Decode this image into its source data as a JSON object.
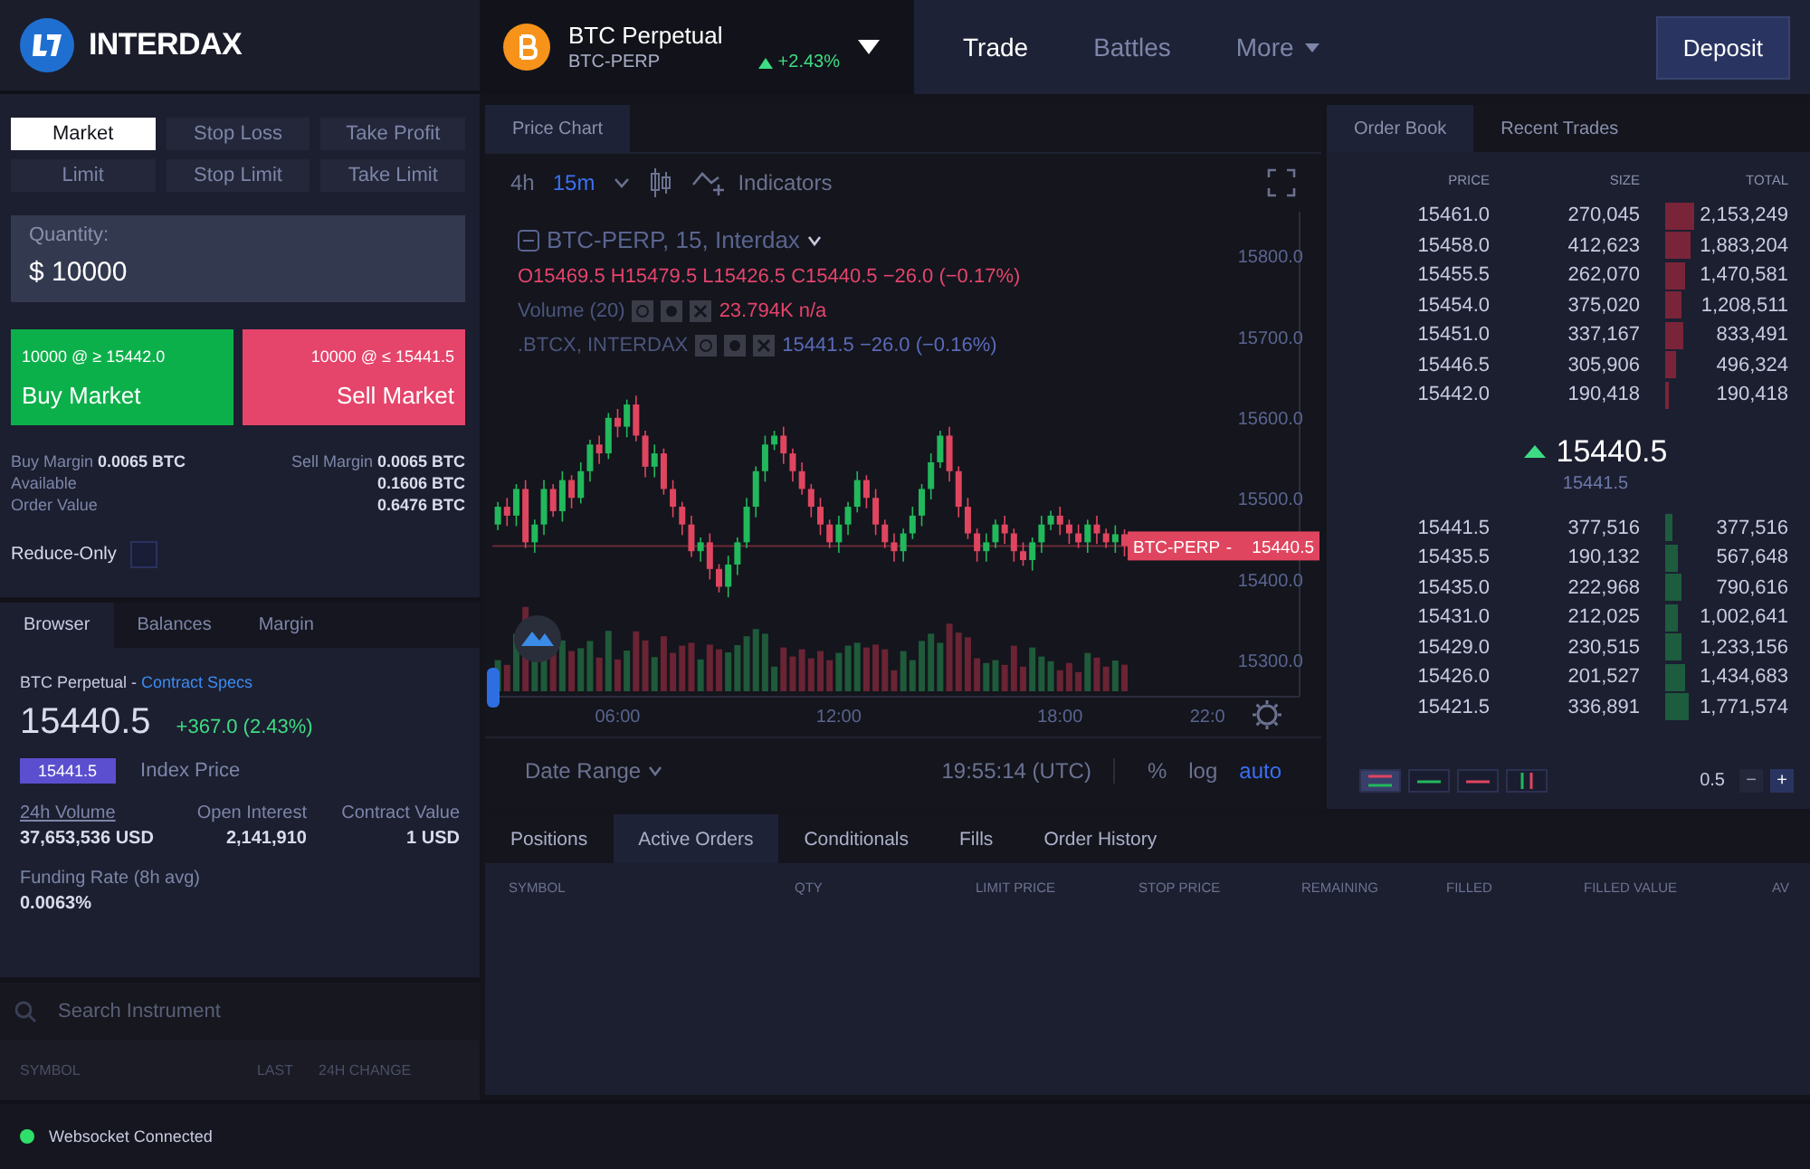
{
  "brand": {
    "name": "INTERDAX"
  },
  "instrument": {
    "name": "BTC Perpetual",
    "symbol": "BTC-PERP",
    "change": "+2.43%"
  },
  "nav": [
    {
      "label": "Trade",
      "selected": true,
      "dropdown": false
    },
    {
      "label": "Battles",
      "selected": false,
      "dropdown": false
    },
    {
      "label": "More",
      "selected": false,
      "dropdown": true
    }
  ],
  "deposit_button": "Deposit",
  "order_types": [
    {
      "label": "Market",
      "selected": true
    },
    {
      "label": "Stop Loss",
      "selected": false
    },
    {
      "label": "Take Profit",
      "selected": false
    },
    {
      "label": "Limit",
      "selected": false
    },
    {
      "label": "Stop Limit",
      "selected": false
    },
    {
      "label": "Take Limit",
      "selected": false
    }
  ],
  "quantity": {
    "label": "Quantity:",
    "value": "$ 10000"
  },
  "buy": {
    "detail": "10000 @ ≥ 15442.0",
    "label": "Buy Market"
  },
  "sell": {
    "detail": "10000 @ ≤ 15441.5",
    "label": "Sell Market"
  },
  "margins": {
    "buy_label": "Buy Margin",
    "buy_value": "0.0065 BTC",
    "sell_label": "Sell Margin",
    "sell_value": "0.0065 BTC"
  },
  "balances": [
    {
      "label": "Available",
      "value": "0.1606 BTC"
    },
    {
      "label": "Order Value",
      "value": "0.6476 BTC"
    }
  ],
  "reduce_only": {
    "label": "Reduce-Only",
    "checked": false
  },
  "info_tabs": [
    {
      "label": "Browser",
      "selected": true
    },
    {
      "label": "Balances",
      "selected": false
    },
    {
      "label": "Margin",
      "selected": false
    }
  ],
  "contract": {
    "title": "BTC Perpetual -",
    "link": "Contract Specs",
    "last": "15440.5",
    "change": "+367.0 (2.43%)",
    "index_value": "15441.5",
    "index_label": "Index Price",
    "stats": [
      {
        "label": "24h Volume",
        "value": "37,653,536 USD",
        "underlined": true
      },
      {
        "label": "Open Interest",
        "value": "2,141,910",
        "underlined": false
      },
      {
        "label": "Contract Value",
        "value": "1 USD",
        "underlined": false
      }
    ],
    "funding": {
      "label": "Funding Rate (8h avg)",
      "value": "0.0063%"
    }
  },
  "search": {
    "placeholder": "Search Instrument"
  },
  "instrument_columns": [
    "SYMBOL",
    "LAST",
    "24H CHANGE"
  ],
  "chart_panel": {
    "tab": "Price Chart",
    "intervals": [
      {
        "label": "4h",
        "selected": false
      },
      {
        "label": "15m",
        "selected": true
      }
    ],
    "indicators": "Indicators",
    "legend": {
      "title": "BTC-PERP, 15, Interdax",
      "ohlc": "O15469.5 H15479.5 L15426.5 C15440.5 −26.0 (−0.17%)",
      "volume_label": "Volume (20)",
      "volume_value": "23.794K n/a",
      "index_label": ".BTCX, INTERDAX",
      "index_value": "15441.5 −26.0 (−0.16%)"
    },
    "chart_data": {
      "type": "candlestick",
      "x": [
        2.75,
        3,
        3.25,
        3.5,
        3.75,
        4,
        4.25,
        4.5,
        4.75,
        5,
        5.25,
        5.5,
        5.75,
        6,
        6.25,
        6.5,
        6.75,
        7,
        7.25,
        7.5,
        7.75,
        8,
        8.25,
        8.5,
        8.75,
        9,
        9.25,
        9.5,
        9.75,
        10,
        10.25,
        10.5,
        10.75,
        11,
        11.25,
        11.5,
        11.75,
        12,
        12.25,
        12.5,
        12.75,
        13,
        13.25,
        13.5,
        13.75,
        14,
        14.25,
        14.5,
        14.75,
        15,
        15.25,
        15.5,
        15.75,
        16,
        16.25,
        16.5,
        16.75,
        17,
        17.25,
        17.5,
        17.75,
        18,
        18.25,
        18.5,
        18.75,
        19,
        19.25,
        19.5,
        19.75
      ],
      "ohlc": [
        [
          15467,
          15495,
          15460,
          15489
        ],
        [
          15489,
          15500,
          15465,
          15478
        ],
        [
          15478,
          15517,
          15465,
          15511
        ],
        [
          15511,
          15522,
          15438,
          15445
        ],
        [
          15445,
          15473,
          15432,
          15467
        ],
        [
          15467,
          15522,
          15454,
          15511
        ],
        [
          15511,
          15517,
          15476.5,
          15483.5
        ],
        [
          15483.5,
          15533,
          15470.5,
          15522
        ],
        [
          15522,
          15528,
          15487,
          15500
        ],
        [
          15500,
          15544,
          15493,
          15533
        ],
        [
          15533,
          15572,
          15520,
          15566
        ],
        [
          15566,
          15577,
          15542,
          15555
        ],
        [
          15555,
          15605,
          15548,
          15599
        ],
        [
          15599,
          15610,
          15575,
          15588
        ],
        [
          15588,
          15621.5,
          15575,
          15615.5
        ],
        [
          15615.5,
          15626.5,
          15570,
          15577
        ],
        [
          15577,
          15583,
          15525.5,
          15538.5
        ],
        [
          15538.5,
          15566,
          15525.5,
          15555
        ],
        [
          15555,
          15561,
          15504,
          15511
        ],
        [
          15511,
          15522,
          15476,
          15489
        ],
        [
          15489,
          15495,
          15454,
          15467
        ],
        [
          15467,
          15478,
          15427,
          15434
        ],
        [
          15434,
          15451,
          15421,
          15445
        ],
        [
          15445,
          15456,
          15399,
          15412
        ],
        [
          15412,
          15418,
          15383,
          15390
        ],
        [
          15390,
          15428.5,
          15377,
          15417.5
        ],
        [
          15417.5,
          15451,
          15404.5,
          15445
        ],
        [
          15445,
          15500,
          15438,
          15489
        ],
        [
          15489,
          15539,
          15476,
          15533
        ],
        [
          15533,
          15577,
          15520,
          15566
        ],
        [
          15566,
          15583,
          15559,
          15577
        ],
        [
          15577,
          15588,
          15542,
          15555
        ],
        [
          15555,
          15561,
          15520,
          15533
        ],
        [
          15533,
          15544,
          15504,
          15511
        ],
        [
          15511,
          15517,
          15476,
          15489
        ],
        [
          15489,
          15500,
          15454,
          15467
        ],
        [
          15467,
          15473,
          15438,
          15445
        ],
        [
          15445,
          15478,
          15432,
          15467
        ],
        [
          15467,
          15495,
          15454,
          15489
        ],
        [
          15489,
          15533,
          15482,
          15522
        ],
        [
          15522,
          15528,
          15487,
          15500
        ],
        [
          15500,
          15511,
          15454,
          15467
        ],
        [
          15467,
          15473,
          15438,
          15445
        ],
        [
          15445,
          15456,
          15421,
          15434
        ],
        [
          15434,
          15462,
          15421,
          15456
        ],
        [
          15456,
          15489,
          15449,
          15478
        ],
        [
          15478,
          15517,
          15465,
          15511
        ],
        [
          15511,
          15555,
          15498,
          15544
        ],
        [
          15544,
          15583,
          15537,
          15577
        ],
        [
          15577,
          15588,
          15520,
          15533
        ],
        [
          15533,
          15539,
          15476,
          15489
        ],
        [
          15489,
          15500,
          15449,
          15456
        ],
        [
          15456,
          15462,
          15421,
          15434
        ],
        [
          15434,
          15456,
          15421,
          15445
        ],
        [
          15445,
          15473,
          15438,
          15467
        ],
        [
          15467,
          15478,
          15443,
          15456
        ],
        [
          15456,
          15462,
          15421,
          15434
        ],
        [
          15434,
          15445,
          15416,
          15423
        ],
        [
          15423,
          15451,
          15410,
          15445
        ],
        [
          15445,
          15478,
          15432,
          15467
        ],
        [
          15467,
          15484,
          15460,
          15478
        ],
        [
          15478,
          15489,
          15454,
          15467
        ],
        [
          15467,
          15473,
          15443,
          15456
        ],
        [
          15456,
          15467,
          15438,
          15445
        ],
        [
          15445,
          15473,
          15432,
          15467
        ],
        [
          15467,
          15478,
          15443,
          15456
        ],
        [
          15456,
          15462,
          15438,
          15445
        ],
        [
          15445,
          15466,
          15432,
          15455
        ],
        [
          15455,
          15461,
          15427.5,
          15440.5
        ]
      ],
      "xlim": [
        2.6,
        24.5
      ],
      "ylim": [
        15254,
        15854
      ],
      "ref_lines": [
        {
          "axis": "y",
          "value": 15440.5
        }
      ],
      "xticks": [
        {
          "value": 6,
          "label": "06:00"
        },
        {
          "value": 12,
          "label": "12:00"
        },
        {
          "value": 18,
          "label": "18:00"
        },
        {
          "value": 22,
          "label": "22:0"
        }
      ],
      "yticks": [
        {
          "value": 15800,
          "label": "15800.0"
        },
        {
          "value": 15700,
          "label": "15700.0"
        },
        {
          "value": 15600,
          "label": "15600.0"
        },
        {
          "value": 15500,
          "label": "15500.0"
        },
        {
          "value": 15400,
          "label": "15400.0"
        },
        {
          "value": 15300,
          "label": "15300.0"
        }
      ]
    },
    "price_tag": {
      "symbol": "BTC-PERP",
      "separator": "-",
      "value": "15440.5"
    },
    "date_range": "Date Range",
    "clock": "19:55:14 (UTC)",
    "scale_options": [
      {
        "label": "%",
        "selected": false
      },
      {
        "label": "log",
        "selected": false
      },
      {
        "label": "auto",
        "selected": true
      }
    ]
  },
  "order_book": {
    "tabs": [
      {
        "label": "Order Book",
        "selected": true
      },
      {
        "label": "Recent Trades",
        "selected": false
      }
    ],
    "columns": [
      "PRICE",
      "SIZE",
      "TOTAL"
    ],
    "asks": [
      {
        "price": "15461.0",
        "size": "270,045",
        "total": "2,153,249"
      },
      {
        "price": "15458.0",
        "size": "412,623",
        "total": "1,883,204"
      },
      {
        "price": "15455.5",
        "size": "262,070",
        "total": "1,470,581"
      },
      {
        "price": "15454.0",
        "size": "375,020",
        "total": "1,208,511"
      },
      {
        "price": "15451.0",
        "size": "337,167",
        "total": "833,491"
      },
      {
        "price": "15446.5",
        "size": "305,906",
        "total": "496,324"
      },
      {
        "price": "15442.0",
        "size": "190,418",
        "total": "190,418"
      }
    ],
    "mid": {
      "price": "15440.5",
      "index": "15441.5"
    },
    "bids": [
      {
        "price": "15441.5",
        "size": "377,516",
        "total": "377,516"
      },
      {
        "price": "15435.5",
        "size": "190,132",
        "total": "567,648"
      },
      {
        "price": "15435.0",
        "size": "222,968",
        "total": "790,616"
      },
      {
        "price": "15431.0",
        "size": "212,025",
        "total": "1,002,641"
      },
      {
        "price": "15429.0",
        "size": "230,515",
        "total": "1,233,156"
      },
      {
        "price": "15426.0",
        "size": "201,527",
        "total": "1,434,683"
      },
      {
        "price": "15421.5",
        "size": "336,891",
        "total": "1,771,574"
      }
    ],
    "display_modes": [
      {
        "kind": "both",
        "selected": true
      },
      {
        "kind": "bids",
        "selected": false
      },
      {
        "kind": "asks",
        "selected": false
      },
      {
        "kind": "columns",
        "selected": false
      }
    ],
    "grouping": {
      "value": "0.5",
      "decrease": "−",
      "increase": "+"
    }
  },
  "orders": {
    "tabs": [
      {
        "label": "Positions",
        "selected": false
      },
      {
        "label": "Active Orders",
        "selected": true
      },
      {
        "label": "Conditionals",
        "selected": false
      },
      {
        "label": "Fills",
        "selected": false
      },
      {
        "label": "Order History",
        "selected": false
      }
    ],
    "columns": [
      "SYMBOL",
      "QTY",
      "LIMIT PRICE",
      "STOP PRICE",
      "REMAINING",
      "FILLED",
      "FILLED VALUE",
      "AV"
    ]
  },
  "status_bar": {
    "text": "Websocket Connected",
    "connected": true
  }
}
